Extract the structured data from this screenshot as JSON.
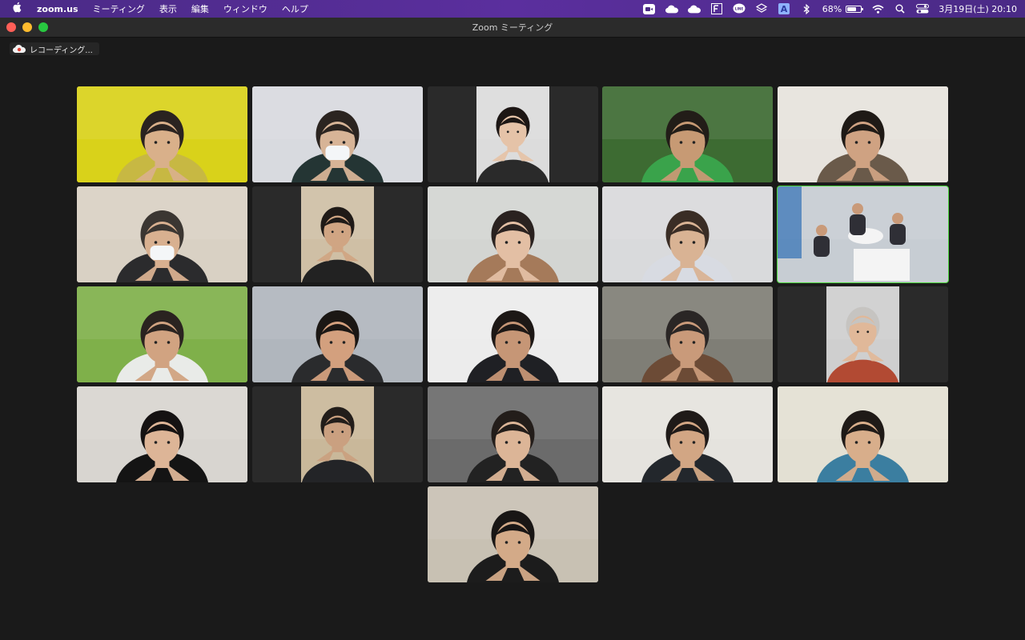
{
  "menubar": {
    "app_name": "zoom.us",
    "menus": [
      "ミーティング",
      "表示",
      "編集",
      "ウィンドウ",
      "ヘルプ"
    ],
    "battery_text": "68%",
    "battery_level": 0.68,
    "datetime": "3月19日(土)  20:10",
    "status_icons": [
      "zoom-icon",
      "cloud-icon",
      "cloud-icon",
      "notes-icon",
      "line-icon",
      "layers-icon",
      "input-source-icon",
      "bluetooth-icon",
      "battery-icon",
      "wifi-icon",
      "spotlight-search-icon",
      "control-center-icon"
    ]
  },
  "window": {
    "title": "Zoom ミーティング",
    "recording_label": "レコーディング..."
  },
  "participants": [
    {
      "bg": "#d9d21a",
      "skin": "#d9b08a",
      "hair": "#2a2320",
      "shirt": "#c7b843"
    },
    {
      "bg": "#d8dadf",
      "skin": "#d7b497",
      "hair": "#2b2420",
      "shirt": "#243534",
      "mask": true
    },
    {
      "bg": "#dcdcdc",
      "skin": "#e5c3a8",
      "hair": "#1c1614",
      "shirt": "#2a2a2a",
      "portrait": true
    },
    {
      "bg": "#3d6b32",
      "skin": "#c79a74",
      "hair": "#221d18",
      "shirt": "#3aa34b"
    },
    {
      "bg": "#e7e3dd",
      "skin": "#cfa282",
      "hair": "#1f1a16",
      "shirt": "#6a5a4a"
    },
    {
      "bg": "#d9d1c4",
      "skin": "#d8b090",
      "hair": "#3b3632",
      "shirt": "#2b2b2d",
      "mask": true
    },
    {
      "bg": "#cfbfa5",
      "skin": "#d0a583",
      "hair": "#1f1a17",
      "shirt": "#222222",
      "portrait": true
    },
    {
      "bg": "#d3d5d2",
      "skin": "#e3bfa4",
      "hair": "#2a2220",
      "shirt": "#a57a5a"
    },
    {
      "bg": "#d9dadc",
      "skin": "#d9b394",
      "hair": "#3a2d25",
      "shirt": "#d8dbe2"
    },
    {
      "bg": "#c7cdd3",
      "skin": "#c99a79",
      "hair": "#1e1e1e",
      "shirt": "#2f2f36",
      "room": true
    },
    {
      "bg": "#7fb04a",
      "skin": "#d1a381",
      "hair": "#2a2320",
      "shirt": "#e9ebe8"
    },
    {
      "bg": "#b0b6bd",
      "skin": "#d3a07e",
      "hair": "#1b1714",
      "shirt": "#2a2b2d"
    },
    {
      "bg": "#ececec",
      "skin": "#c69676",
      "hair": "#1d1816",
      "shirt": "#1f2024"
    },
    {
      "bg": "#7f7e76",
      "skin": "#c99a7a",
      "hair": "#2a2625",
      "shirt": "#6c4b36"
    },
    {
      "bg": "#cfcfcf",
      "skin": "#e0b899",
      "hair": "#c6c4c1",
      "shirt": "#b24a33",
      "portrait": true
    },
    {
      "bg": "#d8d5d0",
      "skin": "#ddb597",
      "hair": "#151212",
      "shirt": "#141414"
    },
    {
      "bg": "#c9b89a",
      "skin": "#caa080",
      "hair": "#221d1a",
      "shirt": "#232427",
      "portrait": true
    },
    {
      "bg": "#6b6b6b",
      "skin": "#dcb597",
      "hair": "#231d1a",
      "shirt": "#222222"
    },
    {
      "bg": "#e5e3de",
      "skin": "#d2a684",
      "hair": "#1f1a18",
      "shirt": "#23272c"
    },
    {
      "bg": "#e3e0d3",
      "skin": "#d8ae8b",
      "hair": "#1f1a17",
      "shirt": "#3b7ea0"
    },
    {
      "bg": "#c8c1b3",
      "skin": "#d3aa88",
      "hair": "#191615",
      "shirt": "#1c1c1c"
    }
  ]
}
